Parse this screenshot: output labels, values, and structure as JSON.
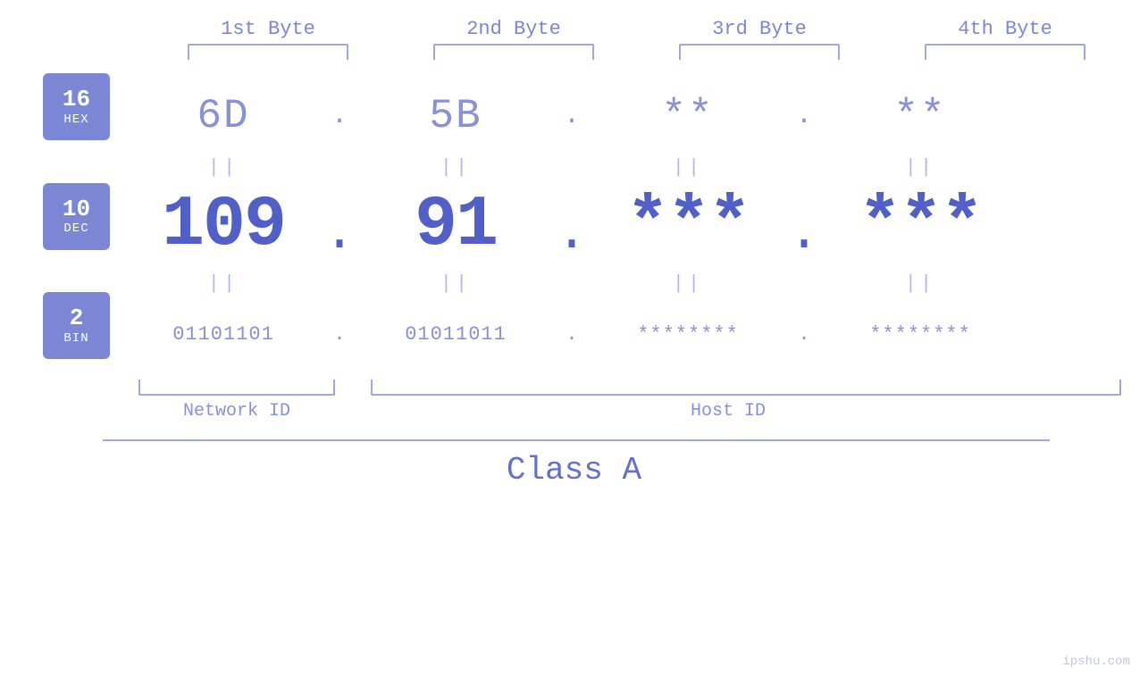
{
  "header": {
    "byte1_label": "1st Byte",
    "byte2_label": "2nd Byte",
    "byte3_label": "3rd Byte",
    "byte4_label": "4th Byte"
  },
  "bases": {
    "hex": {
      "number": "16",
      "name": "HEX"
    },
    "dec": {
      "number": "10",
      "name": "DEC"
    },
    "bin": {
      "number": "2",
      "name": "BIN"
    }
  },
  "values": {
    "hex": {
      "byte1": "6D",
      "sep1": ".",
      "byte2": "5B",
      "sep2": ".",
      "byte3": "**",
      "sep3": ".",
      "byte4": "**"
    },
    "dec": {
      "byte1": "109",
      "sep1": ".",
      "byte2": "91",
      "sep2": ".",
      "byte3": "***",
      "sep3": ".",
      "byte4": "***"
    },
    "bin": {
      "byte1": "01101101",
      "sep1": ".",
      "byte2": "01011011",
      "sep2": ".",
      "byte3": "********",
      "sep3": ".",
      "byte4": "********"
    }
  },
  "equals": "||",
  "labels": {
    "network_id": "Network ID",
    "host_id": "Host ID",
    "class": "Class A"
  },
  "watermark": "ipshu.com",
  "colors": {
    "accent": "#7b86d4",
    "light_accent": "#8891d8",
    "dark_accent": "#5060c8",
    "bracket": "#a0a8e0",
    "bg": "#ffffff"
  }
}
